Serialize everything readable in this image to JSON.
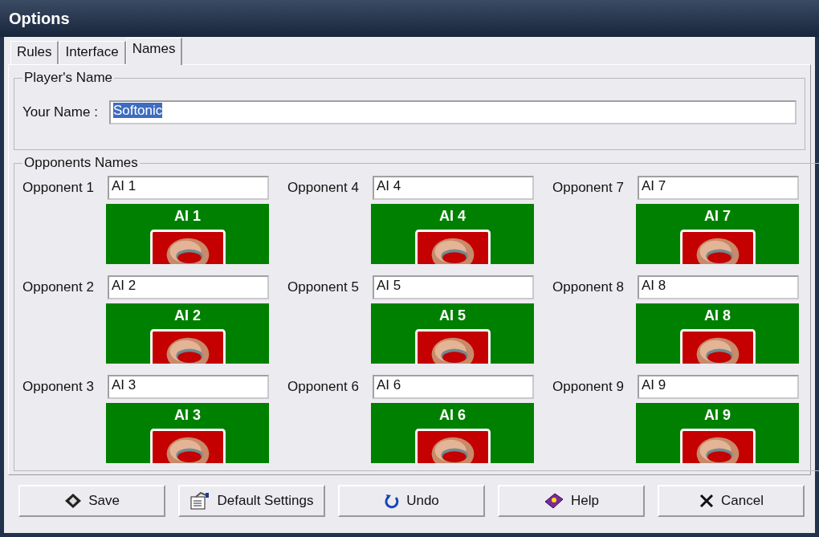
{
  "window": {
    "title": "Options"
  },
  "tabs": [
    {
      "label": "Rules",
      "selected": false
    },
    {
      "label": "Interface",
      "selected": false
    },
    {
      "label": "Names",
      "selected": true
    }
  ],
  "players_name": {
    "legend": "Player's Name",
    "label": "Your Name :",
    "value": "Softonic"
  },
  "opponents": {
    "legend": "Opponents Names",
    "items": [
      {
        "label": "Opponent 1",
        "value": "AI 1",
        "card_title": "AI 1"
      },
      {
        "label": "Opponent 2",
        "value": "AI 2",
        "card_title": "AI 2"
      },
      {
        "label": "Opponent 3",
        "value": "AI 3",
        "card_title": "AI 3"
      },
      {
        "label": "Opponent 4",
        "value": "AI 4",
        "card_title": "AI 4"
      },
      {
        "label": "Opponent 5",
        "value": "AI 5",
        "card_title": "AI 5"
      },
      {
        "label": "Opponent 6",
        "value": "AI 6",
        "card_title": "AI 6"
      },
      {
        "label": "Opponent 7",
        "value": "AI 7",
        "card_title": "AI 7"
      },
      {
        "label": "Opponent 8",
        "value": "AI 8",
        "card_title": "AI 8"
      },
      {
        "label": "Opponent 9",
        "value": "AI 9",
        "card_title": "AI 9"
      }
    ]
  },
  "buttons": [
    {
      "label": "Save",
      "kind": "save"
    },
    {
      "label": "Default Settings",
      "kind": "defaults"
    },
    {
      "label": "Undo",
      "kind": "undo"
    },
    {
      "label": "Help",
      "kind": "help"
    },
    {
      "label": "Cancel",
      "kind": "cancel"
    }
  ]
}
